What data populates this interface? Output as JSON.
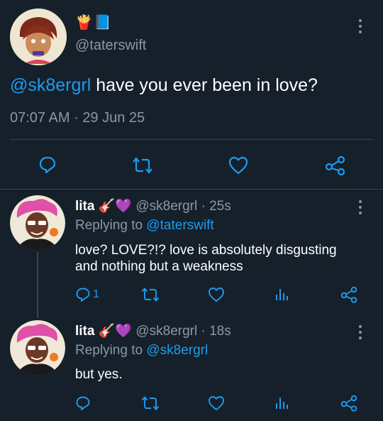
{
  "main_tweet": {
    "header_emojis": [
      "🍟",
      "📘"
    ],
    "handle": "@taterswift",
    "mention": "@sk8ergrl",
    "body": " have you ever been in love?",
    "time": "07:07 AM",
    "separator": "·",
    "date": "29 Jun 25"
  },
  "replies": [
    {
      "name": "lita",
      "name_emojis": "🎸💜",
      "handle": "@sk8ergrl",
      "separator": "·",
      "time": "25s",
      "replying_prefix": "Replying to",
      "replying_handle": "@taterswift",
      "body_line1": "love? LOVE?!? love is absolutely disgusting",
      "body_line2": "and nothing but a weakness",
      "reply_count": "1"
    },
    {
      "name": "lita",
      "name_emojis": "🎸💜",
      "handle": "@sk8ergrl",
      "separator": "·",
      "time": "18s",
      "replying_prefix": "Replying to",
      "replying_handle": "@sk8ergrl",
      "body_line1": "but yes.",
      "reply_count": ""
    }
  ],
  "icons": [
    "reply-icon",
    "retweet-icon",
    "like-icon",
    "share-icon",
    "analytics-icon",
    "more-options-icon"
  ],
  "colors": {
    "background": "#15202b",
    "link": "#1d9bf0",
    "muted": "#8899a6",
    "divider": "#38444d"
  }
}
